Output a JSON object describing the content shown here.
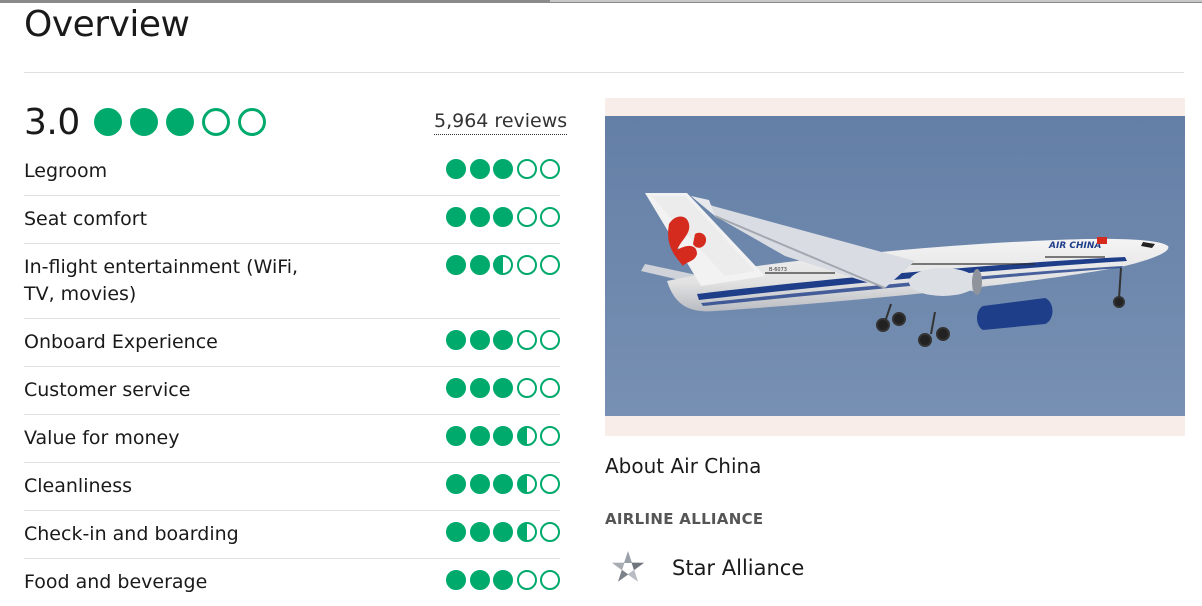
{
  "page": {
    "title": "Overview"
  },
  "overall": {
    "score": "3.0",
    "rating": 3,
    "reviews_label": "5,964 reviews"
  },
  "ratings": [
    {
      "label": "Legroom",
      "rating": 3
    },
    {
      "label": "Seat comfort",
      "rating": 3
    },
    {
      "label": "In-flight entertainment (WiFi, TV, movies)",
      "rating": 2.5
    },
    {
      "label": "Onboard Experience",
      "rating": 3
    },
    {
      "label": "Customer service",
      "rating": 3
    },
    {
      "label": "Value for money",
      "rating": 3.5
    },
    {
      "label": "Cleanliness",
      "rating": 3.5
    },
    {
      "label": "Check-in and boarding",
      "rating": 3.5
    },
    {
      "label": "Food and beverage",
      "rating": 3
    }
  ],
  "about": {
    "heading": "About Air China",
    "alliance_label": "AIRLINE ALLIANCE",
    "alliance_name": "Star Alliance",
    "plane_livery_text": "AIR CHINA",
    "plane_registration": "B-6073"
  },
  "colors": {
    "bubble": "#00aa6c",
    "sky": "#6d87ad",
    "photo_frame": "#f8ede8"
  }
}
